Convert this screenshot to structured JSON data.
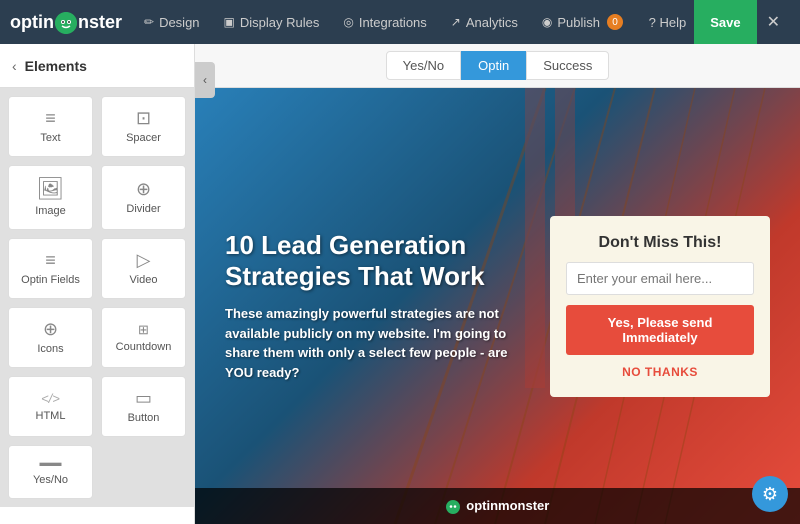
{
  "header": {
    "logo_text_start": "optinm",
    "logo_text_end": "nster",
    "nav_items": [
      {
        "label": "Design",
        "icon": "✏"
      },
      {
        "label": "Display Rules",
        "icon": "▣"
      },
      {
        "label": "Integrations",
        "icon": "◎"
      },
      {
        "label": "Analytics",
        "icon": "↗"
      },
      {
        "label": "Publish",
        "icon": "◉",
        "badge": "0"
      }
    ],
    "help_label": "? Help",
    "save_label": "Save",
    "close_label": "✕"
  },
  "sidebar": {
    "back_label": "‹",
    "title": "Elements",
    "items": [
      {
        "label": "Text",
        "icon": "≡"
      },
      {
        "label": "Spacer",
        "icon": "⊡"
      },
      {
        "label": "Image",
        "icon": "⬜"
      },
      {
        "label": "Divider",
        "icon": "⊕"
      },
      {
        "label": "Optin Fields",
        "icon": "≡"
      },
      {
        "label": "Video",
        "icon": "▷"
      },
      {
        "label": "Icons",
        "icon": "⊕"
      },
      {
        "label": "Countdown",
        "icon": "⊞"
      },
      {
        "label": "HTML",
        "icon": "✦"
      },
      {
        "label": "Button",
        "icon": "▭"
      },
      {
        "label": "Yes/No",
        "icon": "▬"
      }
    ]
  },
  "tabs": [
    {
      "label": "Yes/No",
      "id": "yes-no"
    },
    {
      "label": "Optin",
      "id": "optin",
      "active": true
    },
    {
      "label": "Success",
      "id": "success"
    }
  ],
  "canvas": {
    "headline": "10 Lead Generation Strategies That Work",
    "subtext": "These amazingly powerful strategies are not available publicly on my website. I'm going to share them with only a select few people - are YOU ready?",
    "form": {
      "title": "Don't Miss This!",
      "email_placeholder": "Enter your email here...",
      "submit_label": "Yes, Please send Immediately",
      "no_thanks_label": "NO THANKS"
    },
    "branding": "optinmonster"
  }
}
